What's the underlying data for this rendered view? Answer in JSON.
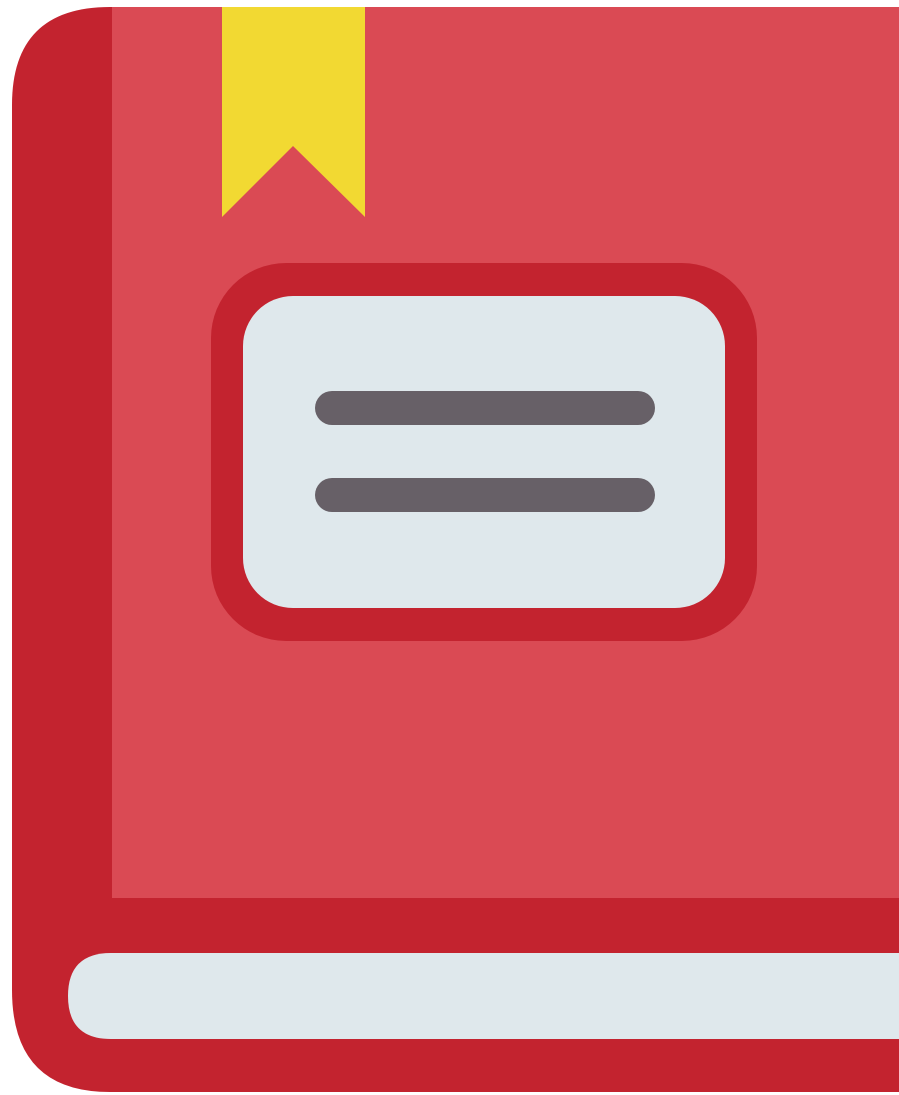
{
  "icon": {
    "name": "book-icon",
    "parts": [
      "book-spine",
      "book-cover",
      "bookmark-ribbon",
      "cover-label",
      "label-line",
      "page-edge"
    ]
  },
  "colors": {
    "spine": "#c3232f",
    "cover": "#da4a54",
    "bookmark": "#f2d932",
    "label_frame": "#c3232f",
    "label_fill": "#dfe8ec",
    "label_lines": "#676067",
    "page_edge": "#dfe8ec",
    "background": "#ffffff"
  }
}
